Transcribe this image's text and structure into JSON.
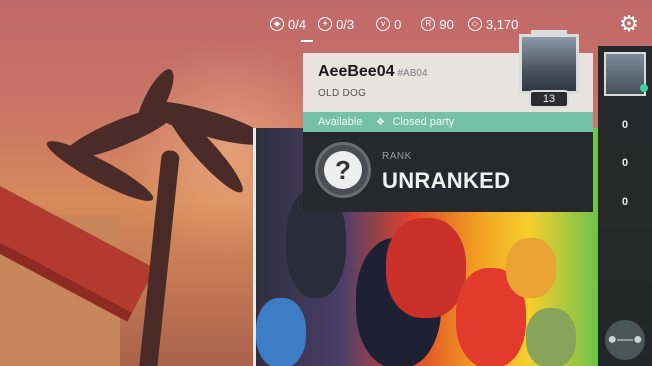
{
  "topbar": {
    "stats": [
      {
        "icon": "triangle-diamond-icon",
        "value": "0/4"
      },
      {
        "icon": "star-circle-icon",
        "value": "0/3"
      },
      {
        "icon": "chevron-coin-icon",
        "value": "0"
      },
      {
        "icon": "radianite-icon",
        "value": "90"
      },
      {
        "icon": "valorant-points-icon",
        "value": "3,170"
      }
    ],
    "settings_icon": "gear-icon"
  },
  "player": {
    "name": "AeeBee04",
    "tag": "#AB04",
    "title": "OLD DOG",
    "level": "13"
  },
  "status": {
    "availability": "Available",
    "party": "Closed party",
    "party_icon": "party-diamond-icon"
  },
  "rank": {
    "label": "RANK",
    "value": "UNRANKED",
    "badge_icon": "question-icon"
  },
  "sidebar": {
    "counts": [
      "0",
      "0",
      "0"
    ],
    "bottom_icon": "sunglasses-icon"
  },
  "colors": {
    "status_green": "#74c1a8",
    "card_bg": "#e7e4e0",
    "rank_bg": "#27282d"
  }
}
